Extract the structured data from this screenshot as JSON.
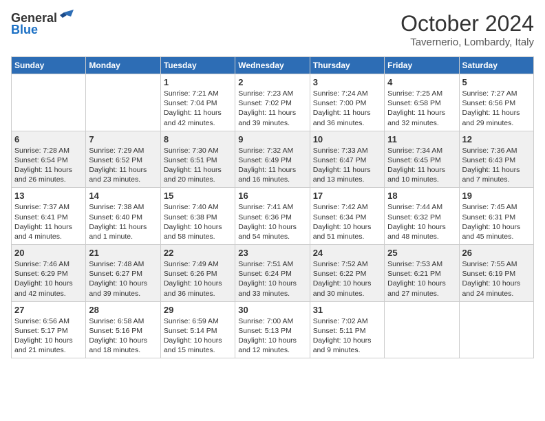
{
  "header": {
    "logo_general": "General",
    "logo_blue": "Blue",
    "month": "October 2024",
    "location": "Tavernerio, Lombardy, Italy"
  },
  "days_of_week": [
    "Sunday",
    "Monday",
    "Tuesday",
    "Wednesday",
    "Thursday",
    "Friday",
    "Saturday"
  ],
  "weeks": [
    [
      {
        "day": "",
        "info": ""
      },
      {
        "day": "",
        "info": ""
      },
      {
        "day": "1",
        "info": "Sunrise: 7:21 AM\nSunset: 7:04 PM\nDaylight: 11 hours and 42 minutes."
      },
      {
        "day": "2",
        "info": "Sunrise: 7:23 AM\nSunset: 7:02 PM\nDaylight: 11 hours and 39 minutes."
      },
      {
        "day": "3",
        "info": "Sunrise: 7:24 AM\nSunset: 7:00 PM\nDaylight: 11 hours and 36 minutes."
      },
      {
        "day": "4",
        "info": "Sunrise: 7:25 AM\nSunset: 6:58 PM\nDaylight: 11 hours and 32 minutes."
      },
      {
        "day": "5",
        "info": "Sunrise: 7:27 AM\nSunset: 6:56 PM\nDaylight: 11 hours and 29 minutes."
      }
    ],
    [
      {
        "day": "6",
        "info": "Sunrise: 7:28 AM\nSunset: 6:54 PM\nDaylight: 11 hours and 26 minutes."
      },
      {
        "day": "7",
        "info": "Sunrise: 7:29 AM\nSunset: 6:52 PM\nDaylight: 11 hours and 23 minutes."
      },
      {
        "day": "8",
        "info": "Sunrise: 7:30 AM\nSunset: 6:51 PM\nDaylight: 11 hours and 20 minutes."
      },
      {
        "day": "9",
        "info": "Sunrise: 7:32 AM\nSunset: 6:49 PM\nDaylight: 11 hours and 16 minutes."
      },
      {
        "day": "10",
        "info": "Sunrise: 7:33 AM\nSunset: 6:47 PM\nDaylight: 11 hours and 13 minutes."
      },
      {
        "day": "11",
        "info": "Sunrise: 7:34 AM\nSunset: 6:45 PM\nDaylight: 11 hours and 10 minutes."
      },
      {
        "day": "12",
        "info": "Sunrise: 7:36 AM\nSunset: 6:43 PM\nDaylight: 11 hours and 7 minutes."
      }
    ],
    [
      {
        "day": "13",
        "info": "Sunrise: 7:37 AM\nSunset: 6:41 PM\nDaylight: 11 hours and 4 minutes."
      },
      {
        "day": "14",
        "info": "Sunrise: 7:38 AM\nSunset: 6:40 PM\nDaylight: 11 hours and 1 minute."
      },
      {
        "day": "15",
        "info": "Sunrise: 7:40 AM\nSunset: 6:38 PM\nDaylight: 10 hours and 58 minutes."
      },
      {
        "day": "16",
        "info": "Sunrise: 7:41 AM\nSunset: 6:36 PM\nDaylight: 10 hours and 54 minutes."
      },
      {
        "day": "17",
        "info": "Sunrise: 7:42 AM\nSunset: 6:34 PM\nDaylight: 10 hours and 51 minutes."
      },
      {
        "day": "18",
        "info": "Sunrise: 7:44 AM\nSunset: 6:32 PM\nDaylight: 10 hours and 48 minutes."
      },
      {
        "day": "19",
        "info": "Sunrise: 7:45 AM\nSunset: 6:31 PM\nDaylight: 10 hours and 45 minutes."
      }
    ],
    [
      {
        "day": "20",
        "info": "Sunrise: 7:46 AM\nSunset: 6:29 PM\nDaylight: 10 hours and 42 minutes."
      },
      {
        "day": "21",
        "info": "Sunrise: 7:48 AM\nSunset: 6:27 PM\nDaylight: 10 hours and 39 minutes."
      },
      {
        "day": "22",
        "info": "Sunrise: 7:49 AM\nSunset: 6:26 PM\nDaylight: 10 hours and 36 minutes."
      },
      {
        "day": "23",
        "info": "Sunrise: 7:51 AM\nSunset: 6:24 PM\nDaylight: 10 hours and 33 minutes."
      },
      {
        "day": "24",
        "info": "Sunrise: 7:52 AM\nSunset: 6:22 PM\nDaylight: 10 hours and 30 minutes."
      },
      {
        "day": "25",
        "info": "Sunrise: 7:53 AM\nSunset: 6:21 PM\nDaylight: 10 hours and 27 minutes."
      },
      {
        "day": "26",
        "info": "Sunrise: 7:55 AM\nSunset: 6:19 PM\nDaylight: 10 hours and 24 minutes."
      }
    ],
    [
      {
        "day": "27",
        "info": "Sunrise: 6:56 AM\nSunset: 5:17 PM\nDaylight: 10 hours and 21 minutes."
      },
      {
        "day": "28",
        "info": "Sunrise: 6:58 AM\nSunset: 5:16 PM\nDaylight: 10 hours and 18 minutes."
      },
      {
        "day": "29",
        "info": "Sunrise: 6:59 AM\nSunset: 5:14 PM\nDaylight: 10 hours and 15 minutes."
      },
      {
        "day": "30",
        "info": "Sunrise: 7:00 AM\nSunset: 5:13 PM\nDaylight: 10 hours and 12 minutes."
      },
      {
        "day": "31",
        "info": "Sunrise: 7:02 AM\nSunset: 5:11 PM\nDaylight: 10 hours and 9 minutes."
      },
      {
        "day": "",
        "info": ""
      },
      {
        "day": "",
        "info": ""
      }
    ]
  ]
}
